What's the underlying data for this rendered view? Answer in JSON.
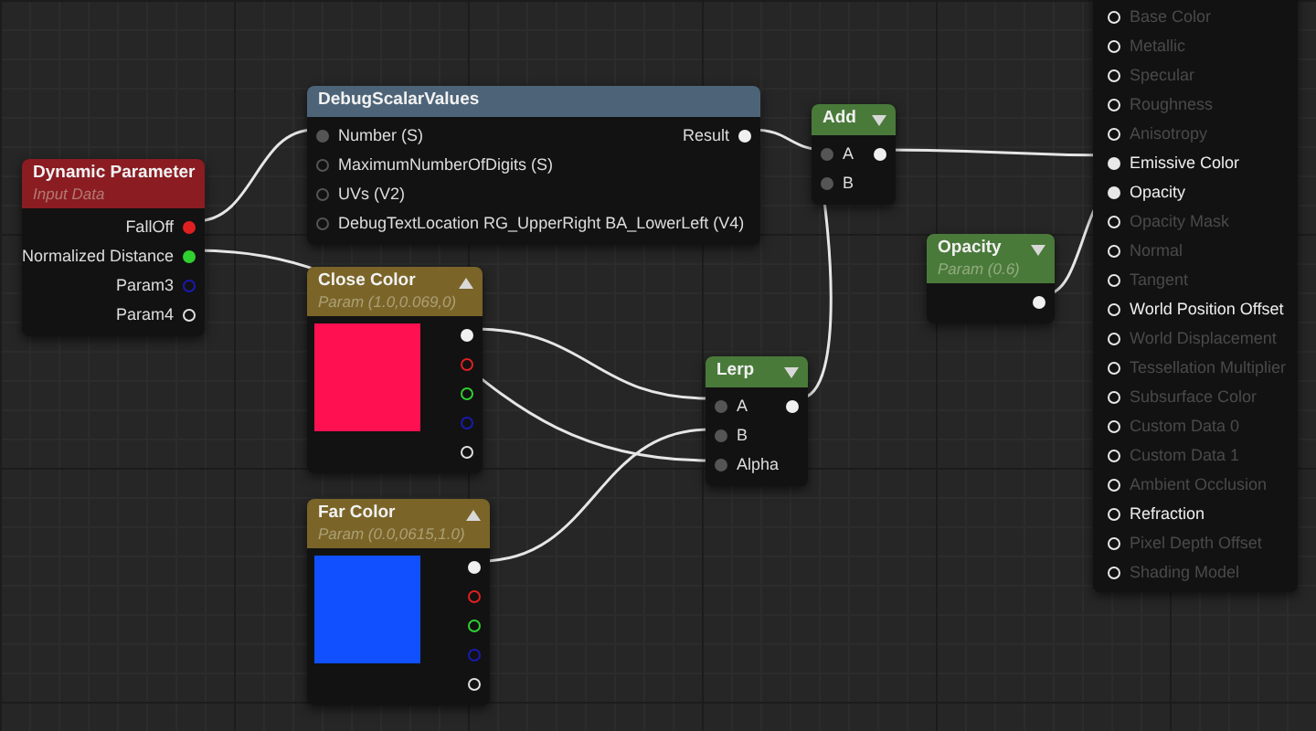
{
  "nodes": [
    {
      "kind": "param",
      "title": "Dynamic Parameter",
      "subtitle": "Input Data",
      "color": "#8a1c22",
      "outputs": [
        {
          "label": "FallOff",
          "color": "#e02020",
          "connected": true
        },
        {
          "label": "Normalized Distance",
          "color": "#30d030",
          "connected": true
        },
        {
          "label": "Param3",
          "color": "#1a1ab0",
          "connected": false
        },
        {
          "label": "Param4",
          "color": "#e0e0e0",
          "connected": false
        }
      ]
    },
    {
      "kind": "param",
      "title": "DebugScalarValues",
      "color": "#4d6478",
      "inputs": [
        {
          "label": "Number (S)",
          "color": "#555555",
          "connected": true
        },
        {
          "label": "MaximumNumberOfDigits (S)",
          "color": "#555555",
          "connected": false
        },
        {
          "label": "UVs (V2)",
          "color": "#555555",
          "connected": false
        },
        {
          "label": "DebugTextLocation RG_UpperRight BA_LowerLeft (V4)",
          "color": "#555555",
          "connected": false
        }
      ],
      "outputs": [
        {
          "label": "Result",
          "color": "#f0f0f0",
          "connected": true
        }
      ]
    },
    {
      "kind": "param",
      "title": "Add",
      "color": "#4a7a3a",
      "expanded": false,
      "inputs": [
        {
          "label": "A",
          "color": "#555555",
          "connected": true
        },
        {
          "label": "B",
          "color": "#555555",
          "connected": true
        }
      ],
      "outputs": [
        {
          "color": "#f0f0f0",
          "connected": true
        }
      ]
    },
    {
      "kind": "color",
      "title": "Close Color",
      "subtitle": "Param (1.0,0.069,0)",
      "color": "#7a6428",
      "expanded": true,
      "swatch": {
        "color": "#ff1050"
      },
      "outputs": [
        {
          "color": "#f0f0f0",
          "connected": true
        },
        {
          "color": "#e02020",
          "connected": false
        },
        {
          "color": "#30d030",
          "connected": false
        },
        {
          "color": "#1a1ab0",
          "connected": false
        },
        {
          "color": "#e0e0e0",
          "connected": false
        }
      ]
    },
    {
      "kind": "color",
      "title": "Far Color",
      "subtitle": "Param (0.0,0615,1.0)",
      "color": "#7a6428",
      "expanded": true,
      "swatch": {
        "color": "#1050ff"
      },
      "outputs": [
        {
          "color": "#f0f0f0",
          "connected": true
        },
        {
          "color": "#e02020",
          "connected": false
        },
        {
          "color": "#30d030",
          "connected": false
        },
        {
          "color": "#1a1ab0",
          "connected": false
        },
        {
          "color": "#e0e0e0",
          "connected": false
        }
      ]
    },
    {
      "kind": "param",
      "title": "Lerp",
      "color": "#4a7a3a",
      "expanded": false,
      "inputs": [
        {
          "label": "A",
          "color": "#555555",
          "connected": true
        },
        {
          "label": "B",
          "color": "#555555",
          "connected": true
        },
        {
          "label": "Alpha",
          "color": "#555555",
          "connected": true
        }
      ],
      "outputs": [
        {
          "color": "#f0f0f0",
          "connected": true
        }
      ]
    },
    {
      "kind": "param",
      "title": "Opacity",
      "subtitle": "Param (0.6)",
      "color": "#4a7a3a",
      "expanded": false,
      "outputs": [
        {
          "color": "#f0f0f0",
          "connected": true
        }
      ]
    },
    {
      "kind": "result",
      "inputs": [
        {
          "label": "Base Color",
          "enabled": false,
          "connected": false
        },
        {
          "label": "Metallic",
          "enabled": false,
          "connected": false
        },
        {
          "label": "Specular",
          "enabled": false,
          "connected": false
        },
        {
          "label": "Roughness",
          "enabled": false,
          "connected": false
        },
        {
          "label": "Anisotropy",
          "enabled": false,
          "connected": false
        },
        {
          "label": "Emissive Color",
          "enabled": true,
          "connected": true
        },
        {
          "label": "Opacity",
          "enabled": true,
          "connected": true
        },
        {
          "label": "Opacity Mask",
          "enabled": false,
          "connected": false
        },
        {
          "label": "Normal",
          "enabled": false,
          "connected": false
        },
        {
          "label": "Tangent",
          "enabled": false,
          "connected": false
        },
        {
          "label": "World Position Offset",
          "enabled": true,
          "connected": false
        },
        {
          "label": "World Displacement",
          "enabled": false,
          "connected": false
        },
        {
          "label": "Tessellation Multiplier",
          "enabled": false,
          "connected": false
        },
        {
          "label": "Subsurface Color",
          "enabled": false,
          "connected": false
        },
        {
          "label": "Custom Data 0",
          "enabled": false,
          "connected": false
        },
        {
          "label": "Custom Data 1",
          "enabled": false,
          "connected": false
        },
        {
          "label": "Ambient Occlusion",
          "enabled": false,
          "connected": false
        },
        {
          "label": "Refraction",
          "enabled": true,
          "connected": false
        },
        {
          "label": "Pixel Depth Offset",
          "enabled": false,
          "connected": false
        },
        {
          "label": "Shading Model",
          "enabled": false,
          "connected": false
        }
      ]
    }
  ]
}
